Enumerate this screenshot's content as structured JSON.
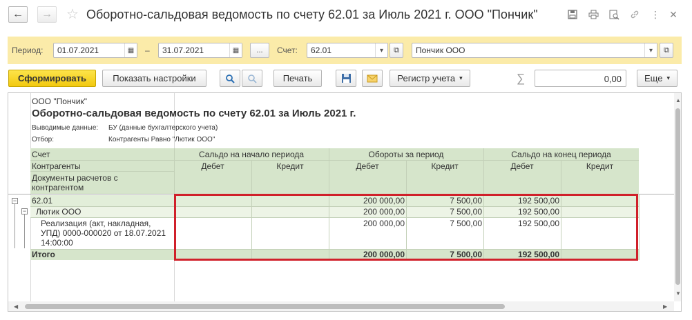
{
  "window": {
    "title": "Оборотно-сальдовая ведомость по счету 62.01 за Июль 2021 г. ООО \"Пончик\"",
    "back_icon": "arrow-left-icon",
    "forward_icon": "arrow-right-icon",
    "favorite_icon": "star-icon"
  },
  "filters": {
    "period_label": "Период:",
    "date_from": "01.07.2021",
    "dash": "–",
    "date_to": "31.07.2021",
    "period_picker": "...",
    "account_label": "Счет:",
    "account": "62.01",
    "organization": "Пончик ООО"
  },
  "toolbar": {
    "generate": "Сформировать",
    "show_settings": "Показать настройки",
    "print": "Печать",
    "registry": "Регистр учета",
    "sum_value": "0,00",
    "more": "Еще"
  },
  "report": {
    "org": "ООО \"Пончик\"",
    "title": "Оборотно-сальдовая ведомость по счету 62.01 за Июль 2021 г.",
    "output_label": "Выводимые данные:",
    "output_value": "БУ (данные бухгалтерского учета)",
    "filter_label": "Отбор:",
    "filter_value": "Контрагенты Равно \"Лютик ООО\"",
    "headers": {
      "account": "Счет",
      "counterparty": "Контрагенты",
      "documents": "Документы расчетов с контрагентом",
      "opening": "Сальдо на начало периода",
      "turnover": "Обороты за период",
      "closing": "Сальдо на конец периода",
      "debit": "Дебет",
      "credit": "Кредит"
    },
    "rows": [
      {
        "label": "62.01",
        "turn_debit": "200 000,00",
        "turn_credit": "7 500,00",
        "close_debit": "192 500,00"
      },
      {
        "label": "Лютик ООО",
        "turn_debit": "200 000,00",
        "turn_credit": "7 500,00",
        "close_debit": "192 500,00"
      },
      {
        "label_line1": "Реализация (акт, накладная,",
        "label_line2": "УПД) 0000-000020 от 18.07.2021",
        "label_line3": "14:00:00",
        "turn_debit": "200 000,00",
        "turn_credit": "7 500,00",
        "close_debit": "192 500,00"
      }
    ],
    "total": {
      "label": "Итого",
      "turn_debit": "200 000,00",
      "turn_credit": "7 500,00",
      "close_debit": "192 500,00"
    }
  },
  "colors": {
    "filter_bg": "#fbeba9",
    "header_green": "#d6e5cb",
    "highlight": "#d0202a",
    "primary_button": "#f2c910"
  }
}
